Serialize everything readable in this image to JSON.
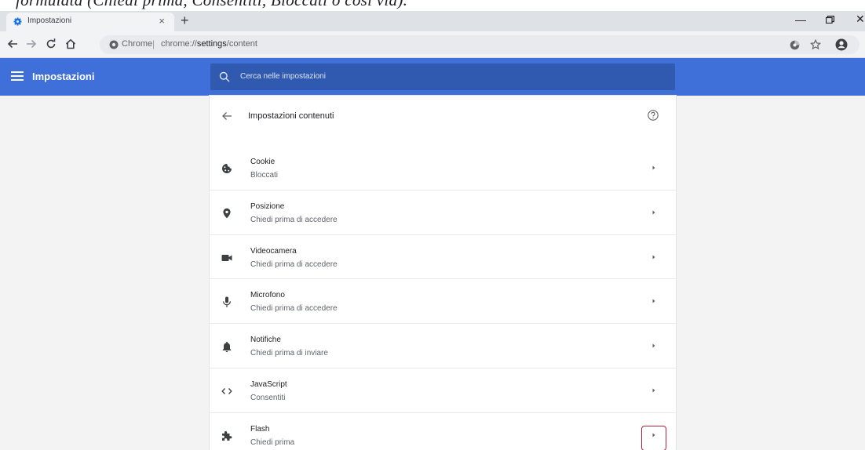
{
  "caption": "formulata (Chiedi prima, Consentiti, Bloccati o così via).",
  "browser": {
    "tab_title": "Impostazioni",
    "omnibox_chip": "Chrome",
    "url_scheme": "chrome://",
    "url_host": "settings",
    "url_path": "/content"
  },
  "header": {
    "title": "Impostazioni",
    "search_placeholder": "Cerca nelle impostazioni",
    "color": "#3f6fd8"
  },
  "page": {
    "title": "Impostazioni contenuti"
  },
  "rows": [
    {
      "label": "Cookie",
      "sub": "Bloccati",
      "icon": "cookie-icon"
    },
    {
      "label": "Posizione",
      "sub": "Chiedi prima di accedere",
      "icon": "location-icon"
    },
    {
      "label": "Videocamera",
      "sub": "Chiedi prima di accedere",
      "icon": "camera-icon"
    },
    {
      "label": "Microfono",
      "sub": "Chiedi prima di accedere",
      "icon": "microphone-icon"
    },
    {
      "label": "Notifiche",
      "sub": "Chiedi prima di inviare",
      "icon": "bell-icon"
    },
    {
      "label": "JavaScript",
      "sub": "Consentiti",
      "icon": "code-icon"
    },
    {
      "label": "Flash",
      "sub": "Chiedi prima",
      "icon": "puzzle-icon"
    }
  ],
  "highlight_color": "#b2223a"
}
